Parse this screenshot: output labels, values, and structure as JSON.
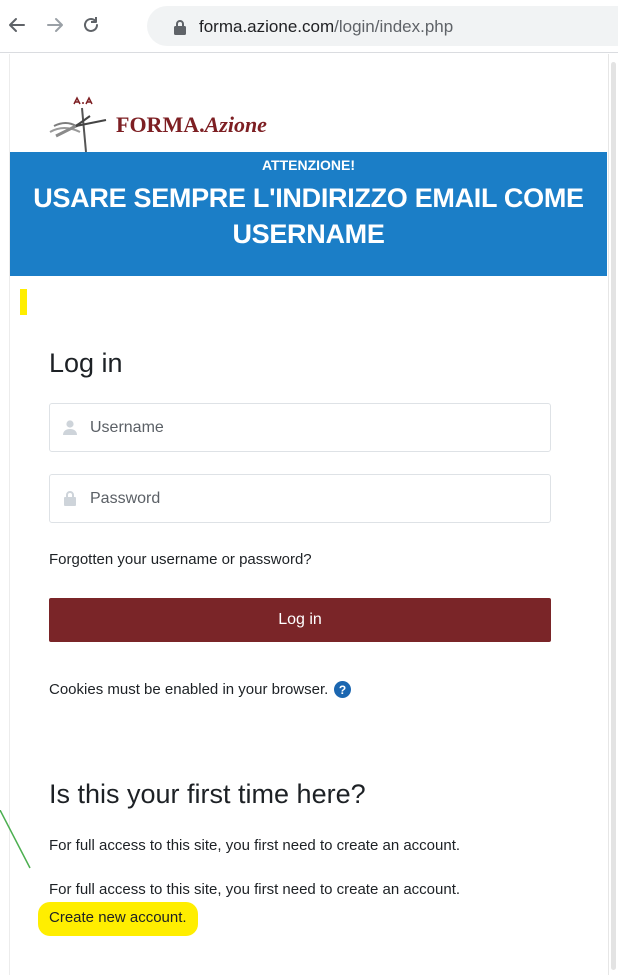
{
  "browser": {
    "url_host": "forma.azione.com",
    "url_path": "/login/index.php",
    "icons": [
      "back-arrow-icon",
      "forward-arrow-icon",
      "reload-icon",
      "lock-icon"
    ]
  },
  "logo": {
    "brand_bold": "FORMA.",
    "brand_italic": "Azione",
    "mark_letters": "A.A",
    "color": "#7d1f23"
  },
  "banner": {
    "subtitle": "ATTENZIONE!",
    "message": "USARE SEMPRE L'INDIRIZZO EMAIL COME USERNAME",
    "color": "#1b7ec7"
  },
  "login": {
    "title": "Log in",
    "username_placeholder": "Username",
    "password_placeholder": "Password",
    "forgot_link": "Forgotten your username or password?",
    "button_label": "Log in",
    "button_color": "#7a2528",
    "cookies_notice": "Cookies must be enabled in your browser."
  },
  "signup": {
    "title": "Is this your first time here?",
    "info_1": "For full access to this site, you first need to create an account.",
    "info_2": "For full access to this site, you first need to create an account.",
    "create_link": "Create new account.",
    "highlight_color": "#ffee00"
  }
}
